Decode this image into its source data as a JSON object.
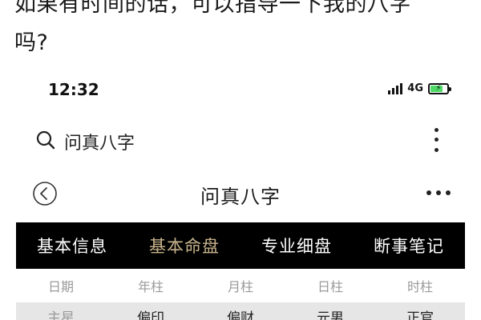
{
  "caption": {
    "line1": "如果有时间的话，可以指导一下我的八字",
    "line2": "吗?"
  },
  "status_bar": {
    "time": "12:32",
    "network": "4G"
  },
  "search": {
    "text": "问真八字"
  },
  "navbar": {
    "title": "问真八字"
  },
  "tabs": [
    {
      "label": "基本信息",
      "active": false
    },
    {
      "label": "基本命盘",
      "active": true
    },
    {
      "label": "专业细盘",
      "active": false
    },
    {
      "label": "断事笔记",
      "active": false
    }
  ],
  "table": {
    "headers": [
      "日期",
      "年柱",
      "月柱",
      "日柱",
      "时柱"
    ],
    "row_label": "主星",
    "row_values": [
      "偏印",
      "偏财",
      "元男",
      "正官"
    ]
  },
  "colors": {
    "tabbar_bg": "#000000",
    "tab_active": "#c8b48c",
    "battery": "#4cd964"
  }
}
